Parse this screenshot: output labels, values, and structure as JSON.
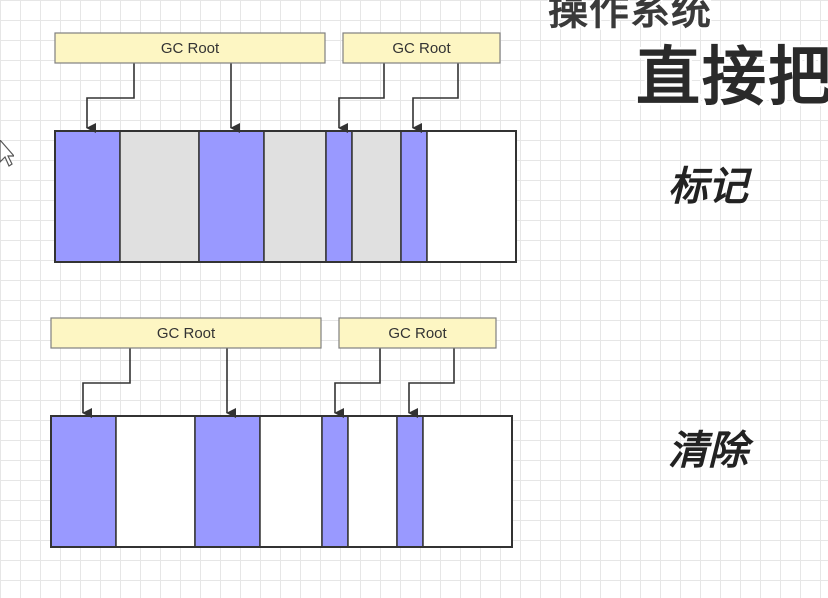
{
  "overlay": {
    "top_text": "操作系统",
    "big_text": "直接把"
  },
  "colors": {
    "marked": "#9999ff",
    "garbage": "#e0e0e0",
    "free": "#ffffff",
    "root_box": "#fdf6c3",
    "root_border": "#808080",
    "stroke": "#333333"
  },
  "panels": [
    {
      "label": "标记",
      "roots": [
        {
          "text": "GC Root"
        },
        {
          "text": "GC Root"
        }
      ],
      "blocks": [
        "marked",
        "garbage",
        "marked",
        "garbage",
        "marked",
        "garbage",
        "marked",
        "free"
      ]
    },
    {
      "label": "清除",
      "roots": [
        {
          "text": "GC Root"
        },
        {
          "text": "GC Root"
        }
      ],
      "blocks": [
        "marked",
        "free",
        "marked",
        "free",
        "marked",
        "free",
        "marked",
        "free"
      ]
    }
  ]
}
